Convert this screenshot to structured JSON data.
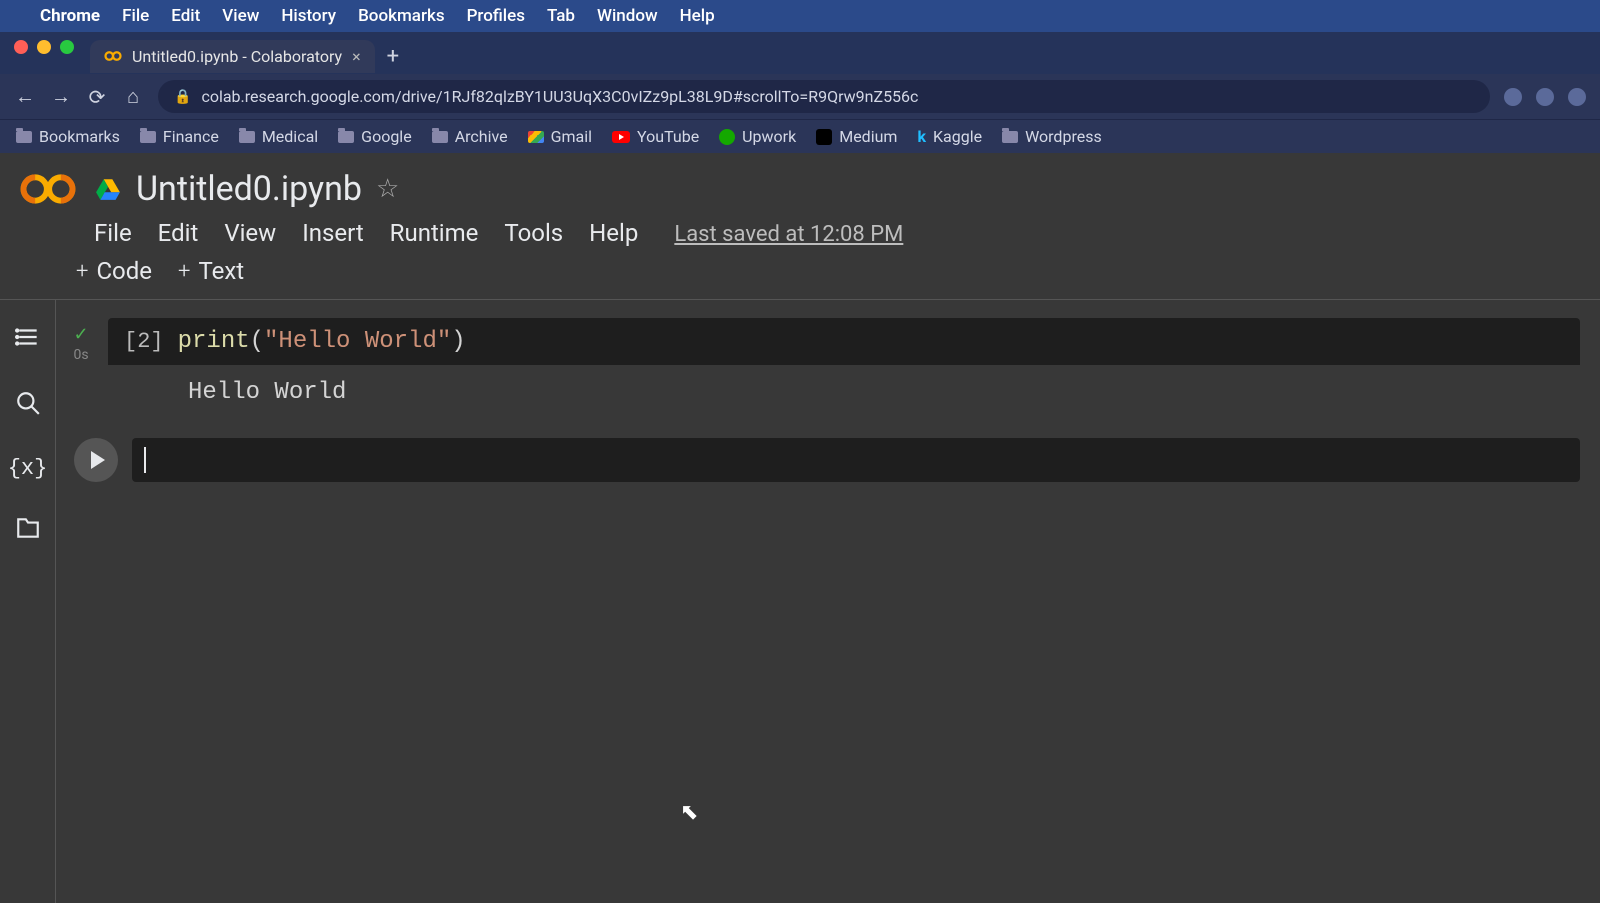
{
  "macos": {
    "app": "Chrome",
    "menus": [
      "File",
      "Edit",
      "View",
      "History",
      "Bookmarks",
      "Profiles",
      "Tab",
      "Window",
      "Help"
    ]
  },
  "browser": {
    "tab_title": "Untitled0.ipynb - Colaboratory",
    "url": "colab.research.google.com/drive/1RJf82qlzBY1UU3UqX3C0vIZz9pL38L9D#scrollTo=R9Qrw9nZ556c"
  },
  "bookmarks": [
    {
      "label": "Bookmarks",
      "type": "folder"
    },
    {
      "label": "Finance",
      "type": "folder"
    },
    {
      "label": "Medical",
      "type": "folder"
    },
    {
      "label": "Google",
      "type": "folder"
    },
    {
      "label": "Archive",
      "type": "folder"
    },
    {
      "label": "Gmail",
      "type": "gmail"
    },
    {
      "label": "YouTube",
      "type": "youtube"
    },
    {
      "label": "Upwork",
      "type": "upwork"
    },
    {
      "label": "Medium",
      "type": "medium"
    },
    {
      "label": "Kaggle",
      "type": "kaggle"
    },
    {
      "label": "Wordpress",
      "type": "folder"
    }
  ],
  "colab": {
    "filename": "Untitled0.ipynb",
    "menus": [
      "File",
      "Edit",
      "View",
      "Insert",
      "Runtime",
      "Tools",
      "Help"
    ],
    "save_status": "Last saved at 12:08 PM",
    "toolbar": {
      "code_label": "Code",
      "text_label": "Text"
    },
    "cells": [
      {
        "exec_count": "[2]",
        "exec_time": "0s",
        "code_fn": "print",
        "code_open": "(",
        "code_str": "\"Hello World\"",
        "code_close": ")",
        "output": "Hello World"
      }
    ]
  }
}
